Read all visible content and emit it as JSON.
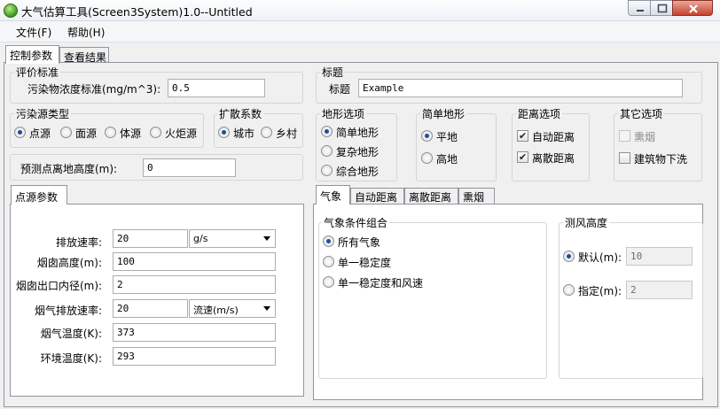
{
  "window": {
    "title": "大气估算工具(Screen3System)1.0--Untitled"
  },
  "menu": {
    "file": "文件(F)",
    "help": "帮助(H)"
  },
  "main_tabs": {
    "params": "控制参数",
    "results": "查看结果"
  },
  "criteria": {
    "group_title": "评价标准",
    "conc_label": "污染物浓度标准(mg/m^3):",
    "conc_value": "0.5"
  },
  "title_group": {
    "group_title": "标题",
    "label": "标题",
    "value": "Example"
  },
  "source_type": {
    "group_title": "污染源类型",
    "options": [
      "点源",
      "面源",
      "体源",
      "火炬源"
    ],
    "selected": "点源"
  },
  "dispersion": {
    "group_title": "扩散系数",
    "options": [
      "城市",
      "乡村"
    ],
    "selected": "城市"
  },
  "receptor": {
    "label": "预测点离地高度(m):",
    "value": "0"
  },
  "terrain": {
    "group_title": "地形选项",
    "options": [
      "简单地形",
      "复杂地形",
      "综合地形"
    ],
    "selected": "简单地形"
  },
  "simple_terrain": {
    "group_title": "简单地形",
    "options": [
      "平地",
      "高地"
    ],
    "selected": "平地"
  },
  "distance": {
    "group_title": "距离选项",
    "auto": "自动距离",
    "discrete": "离散距离"
  },
  "other": {
    "group_title": "其它选项",
    "fumigation": "熏烟",
    "downwash": "建筑物下洗"
  },
  "point_source": {
    "tab": "点源参数",
    "emission_rate_label": "排放速率:",
    "emission_rate_value": "20",
    "emission_rate_unit": "g/s",
    "stack_height_label": "烟囱高度(m):",
    "stack_height_value": "100",
    "stack_diameter_label": "烟囱出口内径(m):",
    "stack_diameter_value": "2",
    "exit_velocity_label": "烟气排放速率:",
    "exit_velocity_value": "20",
    "exit_velocity_unit": "流速(m/s)",
    "gas_temp_label": "烟气温度(K):",
    "gas_temp_value": "373",
    "ambient_temp_label": "环境温度(K):",
    "ambient_temp_value": "293"
  },
  "right_tabs": [
    "气象",
    "自动距离",
    "离散距离",
    "熏烟"
  ],
  "meteorology": {
    "group_title": "气象条件组合",
    "options": [
      "所有气象",
      "单一稳定度",
      "单一稳定度和风速"
    ],
    "selected": "所有气象"
  },
  "anemometer": {
    "group_title": "测风高度",
    "default_label": "默认(m):",
    "default_value": "10",
    "custom_label": "指定(m):",
    "custom_value": "2",
    "selected": "默认"
  }
}
